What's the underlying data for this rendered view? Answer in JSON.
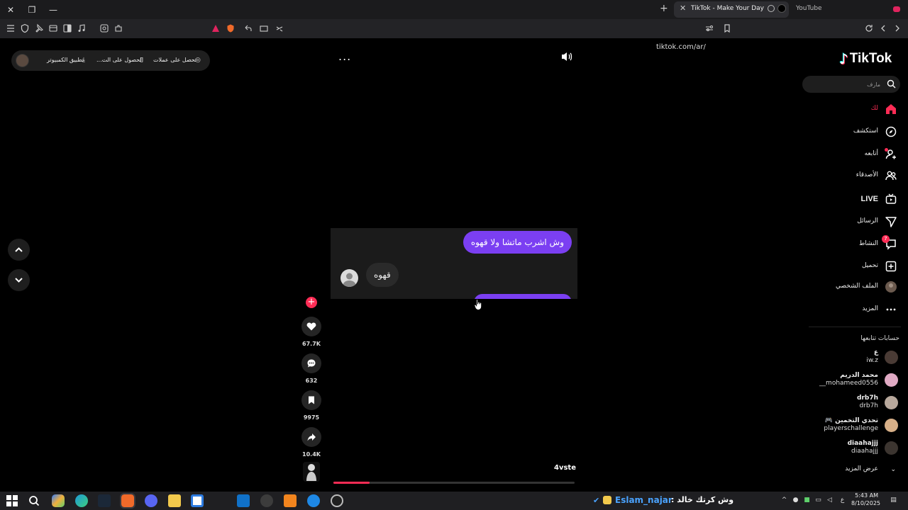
{
  "browser": {
    "tabs": [
      {
        "title": "TikTok - Make Your Day",
        "active": true
      },
      {
        "title": "YouTube",
        "active": false
      }
    ],
    "url": "tiktok.com/ar/"
  },
  "topbar": {
    "promo_items": [
      {
        "label": "تحصل على عملات",
        "icon": "coin-icon"
      },
      {
        "label": "الحصول على الت...",
        "icon": "phone-icon"
      },
      {
        "label": "تطبيق الكمبيوتر",
        "icon": "download-icon"
      }
    ],
    "more_label": "..."
  },
  "logo": {
    "text": "TikTok"
  },
  "search": {
    "placeholder": "مارف"
  },
  "nav": [
    {
      "label": "لك",
      "icon": "home-icon",
      "active": true
    },
    {
      "label": "استكشف",
      "icon": "compass-icon"
    },
    {
      "label": "أتابعه",
      "icon": "user-follow-icon"
    },
    {
      "label": "الأصدقاء",
      "icon": "friends-icon"
    },
    {
      "label": "LIVE",
      "icon": "live-icon"
    },
    {
      "label": "الرسائل",
      "icon": "paper-plane-icon"
    },
    {
      "label": "النشاط",
      "icon": "activity-icon",
      "badge": "7"
    },
    {
      "label": "تحميل",
      "icon": "upload-icon"
    },
    {
      "label": "الملف الشخصي",
      "icon": "profile-avatar"
    },
    {
      "label": "المزيد",
      "icon": "more-icon"
    }
  ],
  "following": {
    "heading": "حسابات تتابعها",
    "accounts": [
      {
        "name": "ع",
        "handle": "iw.z"
      },
      {
        "name": "محمد الدريم",
        "handle": "__mohameed0556"
      },
      {
        "name": "drb7h",
        "handle": "drb7h"
      },
      {
        "name": "تحدي التخمين 🎮",
        "handle": "playerschallenge"
      },
      {
        "name": "diaahajjj",
        "handle": "diaahajjj"
      }
    ],
    "see_more": "عرض المزيد"
  },
  "video": {
    "message_out": "وش اشرب ماتشا ولا قهوه",
    "message_in": "قهوه",
    "creator": "4vste",
    "progress": 0.15
  },
  "actions": {
    "likes": "67.7K",
    "comments": "632",
    "saves": "9975",
    "shares": "10.4K"
  },
  "taskbar": {
    "window_title_prefix": "وش كرتك خالد :",
    "window_title_user": "Eslam_najar",
    "time": "5:43 AM",
    "date": "8/10/2025",
    "lang": "ع"
  },
  "colors": {
    "accent": "#fe2c55",
    "bubble": "#7b3ff2",
    "link": "#4aa3ff"
  }
}
